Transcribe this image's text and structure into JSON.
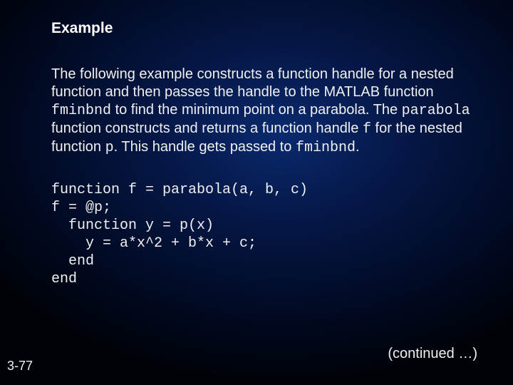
{
  "heading": "Example",
  "para": {
    "t1": "The following example constructs a function handle for a nested function and then passes the handle to the MATLAB function ",
    "c1": "fminbnd",
    "t2": " to find the minimum point on a parabola. The ",
    "c2": "parabola",
    "t3": " function constructs and returns a function handle ",
    "c3": "f",
    "t4": " for the nested function ",
    "c4": "p",
    "t5": ". This handle gets passed to ",
    "c5": "fminbnd",
    "t6": "."
  },
  "code": "function f = parabola(a, b, c)\nf = @p;\n  function y = p(x)\n    y = a*x^2 + b*x + c;\n  end\nend",
  "continued": "(continued …)",
  "pagenum": "3-77"
}
